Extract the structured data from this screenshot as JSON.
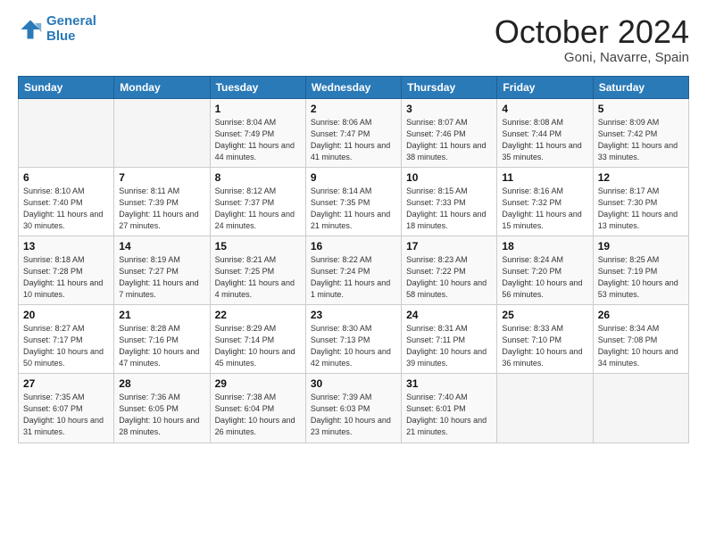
{
  "header": {
    "logo_line1": "General",
    "logo_line2": "Blue",
    "month": "October 2024",
    "location": "Goni, Navarre, Spain"
  },
  "weekdays": [
    "Sunday",
    "Monday",
    "Tuesday",
    "Wednesday",
    "Thursday",
    "Friday",
    "Saturday"
  ],
  "weeks": [
    [
      {
        "day": "",
        "info": ""
      },
      {
        "day": "",
        "info": ""
      },
      {
        "day": "1",
        "info": "Sunrise: 8:04 AM\nSunset: 7:49 PM\nDaylight: 11 hours and 44 minutes."
      },
      {
        "day": "2",
        "info": "Sunrise: 8:06 AM\nSunset: 7:47 PM\nDaylight: 11 hours and 41 minutes."
      },
      {
        "day": "3",
        "info": "Sunrise: 8:07 AM\nSunset: 7:46 PM\nDaylight: 11 hours and 38 minutes."
      },
      {
        "day": "4",
        "info": "Sunrise: 8:08 AM\nSunset: 7:44 PM\nDaylight: 11 hours and 35 minutes."
      },
      {
        "day": "5",
        "info": "Sunrise: 8:09 AM\nSunset: 7:42 PM\nDaylight: 11 hours and 33 minutes."
      }
    ],
    [
      {
        "day": "6",
        "info": "Sunrise: 8:10 AM\nSunset: 7:40 PM\nDaylight: 11 hours and 30 minutes."
      },
      {
        "day": "7",
        "info": "Sunrise: 8:11 AM\nSunset: 7:39 PM\nDaylight: 11 hours and 27 minutes."
      },
      {
        "day": "8",
        "info": "Sunrise: 8:12 AM\nSunset: 7:37 PM\nDaylight: 11 hours and 24 minutes."
      },
      {
        "day": "9",
        "info": "Sunrise: 8:14 AM\nSunset: 7:35 PM\nDaylight: 11 hours and 21 minutes."
      },
      {
        "day": "10",
        "info": "Sunrise: 8:15 AM\nSunset: 7:33 PM\nDaylight: 11 hours and 18 minutes."
      },
      {
        "day": "11",
        "info": "Sunrise: 8:16 AM\nSunset: 7:32 PM\nDaylight: 11 hours and 15 minutes."
      },
      {
        "day": "12",
        "info": "Sunrise: 8:17 AM\nSunset: 7:30 PM\nDaylight: 11 hours and 13 minutes."
      }
    ],
    [
      {
        "day": "13",
        "info": "Sunrise: 8:18 AM\nSunset: 7:28 PM\nDaylight: 11 hours and 10 minutes."
      },
      {
        "day": "14",
        "info": "Sunrise: 8:19 AM\nSunset: 7:27 PM\nDaylight: 11 hours and 7 minutes."
      },
      {
        "day": "15",
        "info": "Sunrise: 8:21 AM\nSunset: 7:25 PM\nDaylight: 11 hours and 4 minutes."
      },
      {
        "day": "16",
        "info": "Sunrise: 8:22 AM\nSunset: 7:24 PM\nDaylight: 11 hours and 1 minute."
      },
      {
        "day": "17",
        "info": "Sunrise: 8:23 AM\nSunset: 7:22 PM\nDaylight: 10 hours and 58 minutes."
      },
      {
        "day": "18",
        "info": "Sunrise: 8:24 AM\nSunset: 7:20 PM\nDaylight: 10 hours and 56 minutes."
      },
      {
        "day": "19",
        "info": "Sunrise: 8:25 AM\nSunset: 7:19 PM\nDaylight: 10 hours and 53 minutes."
      }
    ],
    [
      {
        "day": "20",
        "info": "Sunrise: 8:27 AM\nSunset: 7:17 PM\nDaylight: 10 hours and 50 minutes."
      },
      {
        "day": "21",
        "info": "Sunrise: 8:28 AM\nSunset: 7:16 PM\nDaylight: 10 hours and 47 minutes."
      },
      {
        "day": "22",
        "info": "Sunrise: 8:29 AM\nSunset: 7:14 PM\nDaylight: 10 hours and 45 minutes."
      },
      {
        "day": "23",
        "info": "Sunrise: 8:30 AM\nSunset: 7:13 PM\nDaylight: 10 hours and 42 minutes."
      },
      {
        "day": "24",
        "info": "Sunrise: 8:31 AM\nSunset: 7:11 PM\nDaylight: 10 hours and 39 minutes."
      },
      {
        "day": "25",
        "info": "Sunrise: 8:33 AM\nSunset: 7:10 PM\nDaylight: 10 hours and 36 minutes."
      },
      {
        "day": "26",
        "info": "Sunrise: 8:34 AM\nSunset: 7:08 PM\nDaylight: 10 hours and 34 minutes."
      }
    ],
    [
      {
        "day": "27",
        "info": "Sunrise: 7:35 AM\nSunset: 6:07 PM\nDaylight: 10 hours and 31 minutes."
      },
      {
        "day": "28",
        "info": "Sunrise: 7:36 AM\nSunset: 6:05 PM\nDaylight: 10 hours and 28 minutes."
      },
      {
        "day": "29",
        "info": "Sunrise: 7:38 AM\nSunset: 6:04 PM\nDaylight: 10 hours and 26 minutes."
      },
      {
        "day": "30",
        "info": "Sunrise: 7:39 AM\nSunset: 6:03 PM\nDaylight: 10 hours and 23 minutes."
      },
      {
        "day": "31",
        "info": "Sunrise: 7:40 AM\nSunset: 6:01 PM\nDaylight: 10 hours and 21 minutes."
      },
      {
        "day": "",
        "info": ""
      },
      {
        "day": "",
        "info": ""
      }
    ]
  ]
}
